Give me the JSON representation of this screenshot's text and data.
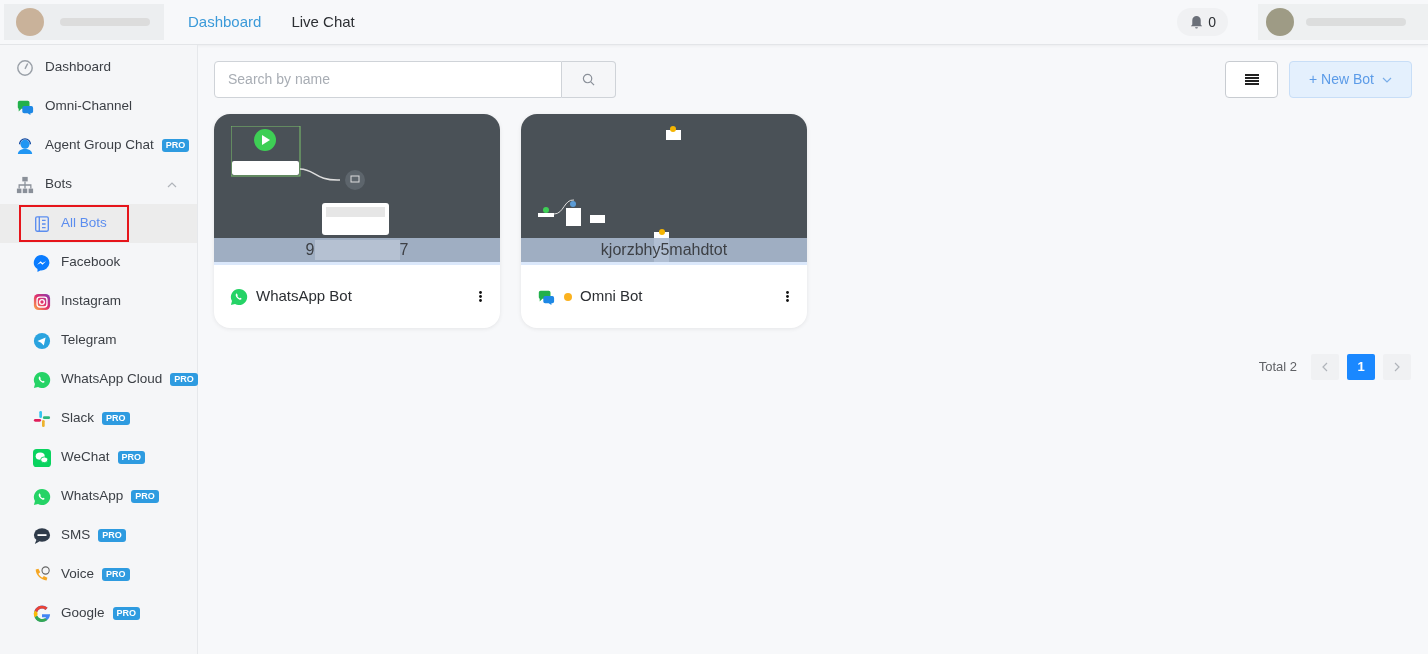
{
  "header": {
    "nav": [
      {
        "label": "Dashboard",
        "selected": true
      },
      {
        "label": "Live Chat",
        "selected": false
      }
    ],
    "notifications": "0"
  },
  "sidebar": {
    "items": [
      {
        "label": "Dashboard",
        "kind": "gauge",
        "selected": false
      },
      {
        "label": "Omni-Channel",
        "kind": "omni",
        "selected": false
      },
      {
        "label": "Agent Group Chat",
        "kind": "agent",
        "badge": "PRO",
        "selected": false
      },
      {
        "label": "Bots",
        "kind": "bots",
        "selected": false,
        "expanded": true,
        "children": [
          {
            "label": "All Bots",
            "kind": "list",
            "selected": true
          },
          {
            "label": "Facebook",
            "kind": "messenger",
            "selected": false
          },
          {
            "label": "Instagram",
            "kind": "instagram",
            "selected": false
          },
          {
            "label": "Telegram",
            "kind": "telegram",
            "selected": false
          },
          {
            "label": "WhatsApp Cloud",
            "kind": "whatsapp",
            "badge": "PRO",
            "selected": false
          },
          {
            "label": "Slack",
            "kind": "slack",
            "badge": "PRO",
            "selected": false
          },
          {
            "label": "WeChat",
            "kind": "wechat",
            "badge": "PRO",
            "selected": false
          },
          {
            "label": "WhatsApp",
            "kind": "whatsapp",
            "badge": "PRO",
            "selected": false
          },
          {
            "label": "SMS",
            "kind": "sms",
            "badge": "PRO",
            "selected": false
          },
          {
            "label": "Voice",
            "kind": "voice",
            "badge": "PRO",
            "selected": false
          },
          {
            "label": "Google",
            "kind": "google",
            "badge": "PRO",
            "selected": false
          }
        ]
      }
    ]
  },
  "toolbar": {
    "search_placeholder": "Search by name",
    "new_button": "+ New Bot"
  },
  "bots": [
    {
      "name": "WhatsApp Bot",
      "kind": "whatsapp",
      "id_start": "9",
      "id_end": "7",
      "redacted": true
    },
    {
      "name": "Omni Bot",
      "kind": "omni",
      "id_start": "kjorzbhy5mahdtot",
      "redacted": false,
      "color": "#fbb21f"
    }
  ],
  "pagination": {
    "total": "Total 2",
    "pages": [
      {
        "label": "1",
        "selected": true
      }
    ]
  }
}
